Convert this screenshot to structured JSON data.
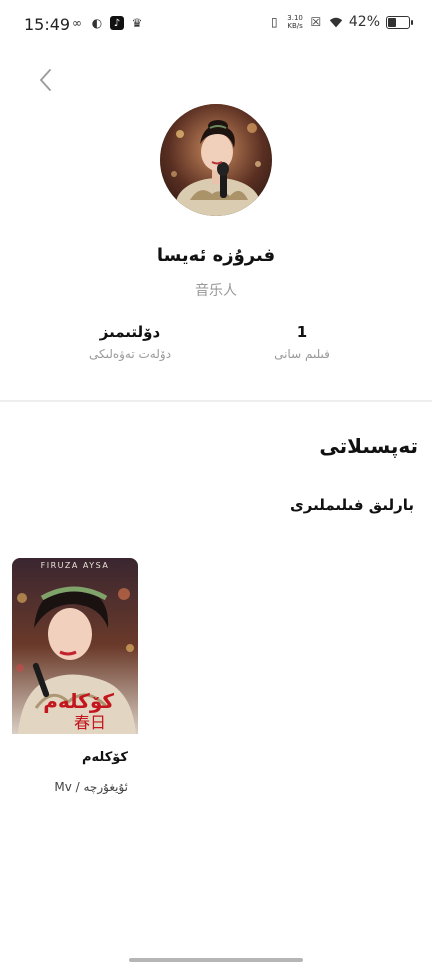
{
  "status": {
    "time": "15:49",
    "speed_top": "3.10",
    "speed_bottom": "KB/s",
    "battery": "42%",
    "battery_level": 0.42
  },
  "profile": {
    "name": "فىرۇزە ئەيسا",
    "role": "音乐人"
  },
  "stats": {
    "left": {
      "value": "دۆلتىمىز",
      "label": "دۆلەت تەۋەلىكى"
    },
    "right": {
      "value": "1",
      "label": "فىلىم سانى"
    }
  },
  "sections": {
    "details": "تەپسىلاتى",
    "all_films": "بارلىق فىلىملىرى"
  },
  "film": {
    "poster_top_text": "FIRUZA  AYSA",
    "poster_title_latin": "كۆكلەم",
    "poster_title_cn": "春日",
    "title": "كۆكلەم",
    "subtitle": "Mv / ئۇيغۇرچە"
  }
}
